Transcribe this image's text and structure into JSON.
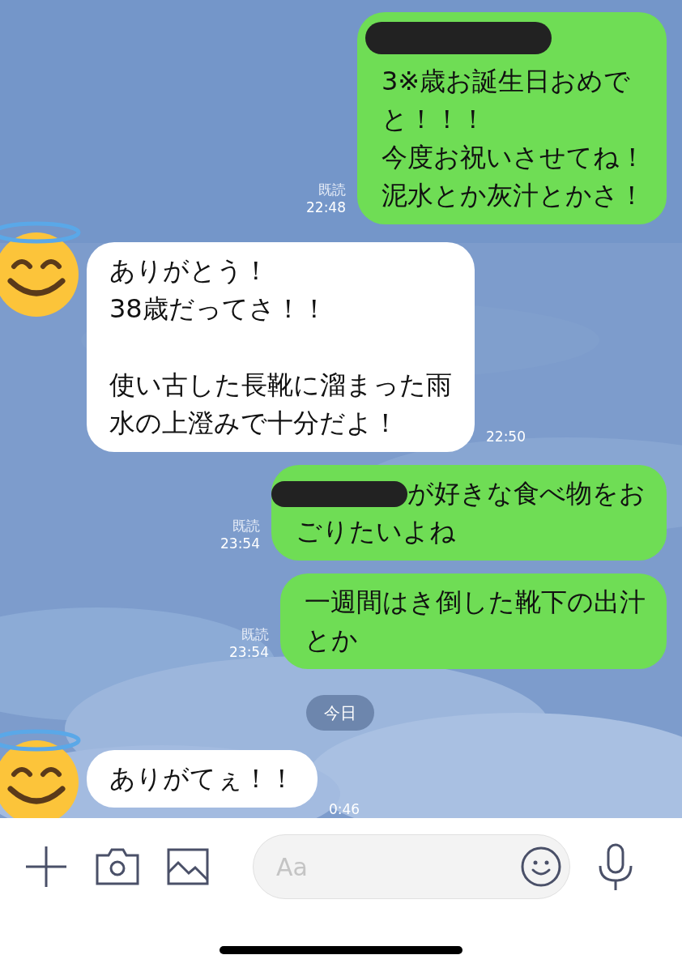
{
  "messages": [
    {
      "kind": "sent",
      "lines": [
        {
          "kind": "redacted"
        },
        {
          "kind": "text",
          "text": "3※歳お誕生日おめで"
        },
        {
          "kind": "text",
          "text": "と！！！"
        },
        {
          "kind": "text",
          "text": "今度お祝いさせてね！"
        },
        {
          "kind": "text",
          "text": "泥水とか灰汁とかさ！"
        }
      ],
      "read": "既読",
      "time": "22:48"
    },
    {
      "kind": "received",
      "lines": [
        {
          "kind": "text",
          "text": "ありがとう！"
        },
        {
          "kind": "text",
          "text": "38歳だってさ！！"
        },
        {
          "kind": "blank"
        },
        {
          "kind": "text",
          "text": "使い古した長靴に溜まった雨"
        },
        {
          "kind": "text",
          "text": "水の上澄みで十分だよ！"
        }
      ],
      "time": "22:50"
    },
    {
      "kind": "sent",
      "lines": [
        {
          "kind": "redacted_text",
          "text": "が好きな食べ物をお"
        },
        {
          "kind": "text",
          "text": "ごりたいよね"
        }
      ],
      "read": "既読",
      "time": "23:54"
    },
    {
      "kind": "sent",
      "lines": [
        {
          "kind": "text",
          "text": "一週間はき倒した靴下の出汁"
        },
        {
          "kind": "text",
          "text": "とか"
        }
      ],
      "read": "既読",
      "time": "23:54"
    },
    {
      "kind": "date",
      "text": "今日"
    },
    {
      "kind": "received",
      "lines": [
        {
          "kind": "text",
          "text": "ありがてぇ！！"
        }
      ],
      "time": "0:46"
    }
  ],
  "input": {
    "placeholder": "Aa"
  }
}
